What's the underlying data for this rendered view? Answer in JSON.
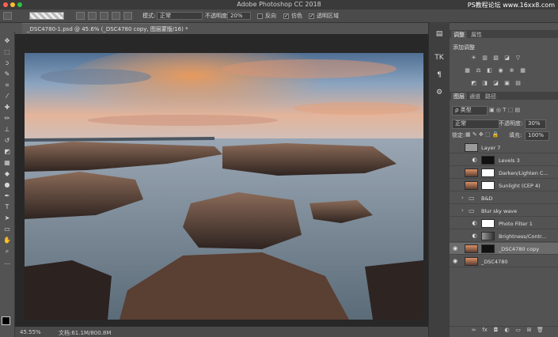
{
  "app": {
    "title": "Adobe Photoshop CC 2018",
    "watermark": "PS教程论坛 www.16xx8.com"
  },
  "options_bar": {
    "mode_label": "模式:",
    "mode_value": "正常",
    "opacity_label": "不透明度:",
    "opacity_value": "20%",
    "reverse_label": "反向",
    "dither_label": "仿色",
    "transparency_label": "透明区域"
  },
  "document": {
    "tab_title": "_DSC4780-1.psd @ 45.6% (_DSC4780 copy, 图层蒙版/16) *"
  },
  "status": {
    "zoom": "45.55%",
    "doc_size": "文档:61.1M/800.8M"
  },
  "adjustments_panel": {
    "tab_active": "调整",
    "tab_other": "属性",
    "add_label": "添加调整"
  },
  "layers_panel": {
    "tabs": [
      "图层",
      "通道",
      "路径"
    ],
    "filter_value": "ρ 类型",
    "blend_mode": "正常",
    "opacity_label": "不透明度:",
    "opacity_value": "30%",
    "lock_label": "锁定:",
    "fill_label": "填充:",
    "fill_value": "100%",
    "layers": [
      {
        "name": "Layer 7",
        "visible": false,
        "kind": "pixel"
      },
      {
        "name": "Levels 3",
        "visible": false,
        "kind": "adjustment"
      },
      {
        "name": "Darken/Lighten C...",
        "visible": false,
        "kind": "masked-photo"
      },
      {
        "name": "Sunlight (CEP 4)",
        "visible": false,
        "kind": "masked-photo"
      },
      {
        "name": "B&D",
        "visible": false,
        "kind": "group"
      },
      {
        "name": "Blur sky wave",
        "visible": false,
        "kind": "group"
      },
      {
        "name": "Photo Filter 1",
        "visible": false,
        "kind": "adjustment"
      },
      {
        "name": "Brightness/Contr...",
        "visible": false,
        "kind": "adjustment"
      },
      {
        "name": "_DSC4780 copy",
        "visible": true,
        "kind": "masked-photo",
        "selected": true
      },
      {
        "name": "_DSC4780",
        "visible": true,
        "kind": "photo"
      }
    ]
  },
  "colors": {
    "accent_red": "#ff5f57",
    "accent_yellow": "#febc2e",
    "accent_green": "#28c840"
  }
}
